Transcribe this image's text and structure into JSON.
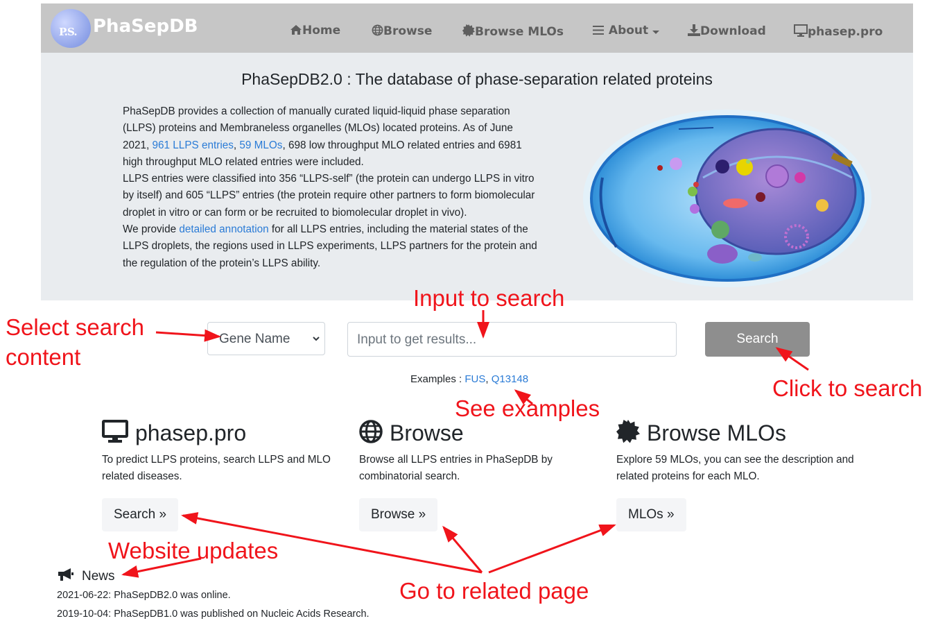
{
  "nav": {
    "logo_text": "P.S.",
    "brand": "PhaSepDB",
    "items": [
      {
        "label": "Home",
        "icon": "home-icon"
      },
      {
        "label": "Browse",
        "icon": "globe-icon"
      },
      {
        "label": "Browse MLOs",
        "icon": "certificate-icon"
      },
      {
        "label": "About",
        "icon": "bars-icon"
      },
      {
        "label": "Download",
        "icon": "download-icon"
      },
      {
        "label": "phasep.pro",
        "icon": "desktop-icon"
      }
    ]
  },
  "jumbotron": {
    "title": "PhaSepDB2.0 : The database of phase-separation related proteins",
    "p1_a": "PhaSepDB provides a collection of manually curated liquid-liquid phase separation (LLPS) proteins and Membraneless organelles (MLOs) located proteins. As of June 2021, ",
    "p1_link1": "961 LLPS entries",
    "p1_sep": ", ",
    "p1_link2": "59 MLOs",
    "p1_b": ", 698 low throughput MLO related entries and 6981 high throughput MLO related entries were included.",
    "p2": "LLPS entries were classified into 356 “LLPS-self” (the protein can undergo LLPS in vitro by itself) and 605 “LLPS” entries (the protein require other partners to form biomolecular droplet in vitro or can form or be recruited to biomolecular droplet in vivo).",
    "p3_a": "We provide ",
    "p3_link": "detailed annotation",
    "p3_b": " for all LLPS entries, including the material states of the LLPS droplets, the regions used in LLPS experiments, LLPS partners for the protein and the regulation of the protein’s LLPS ability."
  },
  "search": {
    "select_value": "Gene Name",
    "input_placeholder": "Input to get results...",
    "button_label": "Search",
    "examples_label": "Examples : ",
    "example1": "FUS",
    "example_sep": ", ",
    "example2": "Q13148"
  },
  "features": [
    {
      "title": "phasep.pro",
      "icon": "desktop-icon",
      "desc": "To predict LLPS proteins, search LLPS and MLO related diseases.",
      "button": "Search »"
    },
    {
      "title": "Browse",
      "icon": "globe-icon",
      "desc": "Browse all LLPS entries in PhaSepDB by combinatorial search.",
      "button": "Browse »"
    },
    {
      "title": "Browse MLOs",
      "icon": "certificate-icon",
      "desc": "Explore 59 MLOs, you can see the description and related proteins for each MLO.",
      "button": "MLOs »"
    }
  ],
  "news": {
    "title": "News",
    "icon": "bullhorn-icon",
    "items": [
      "2021-06-22: PhaSepDB2.0 was online.",
      "2019-10-04: PhaSepDB1.0 was published on Nucleic Acids Research."
    ]
  },
  "annotations": {
    "select": "Select search\ncontent",
    "input": "Input to search",
    "click": "Click to search",
    "examples": "See examples",
    "updates": "Website updates",
    "related": "Go to related page"
  },
  "colors": {
    "navbar": "#c6c6c6",
    "jumbotron": "#e9ecef",
    "link": "#2a7bd6",
    "search_button": "#8e8e8e",
    "annotation": "#f0141b"
  }
}
